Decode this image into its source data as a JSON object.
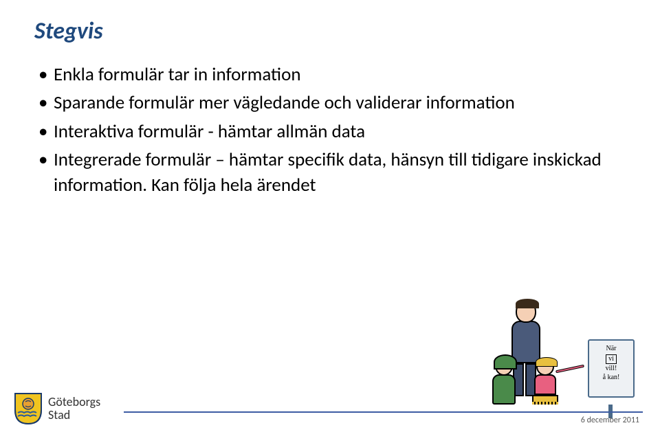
{
  "title": "Stegvis",
  "bullets": [
    "Enkla formulär tar in information",
    "Sparande formulär mer vägledande och validerar information",
    "Interaktiva formulär - hämtar allmän data",
    "Integrerade formulär – hämtar specifik data, hänsyn till tidigare inskickad information. Kan följa hela ärendet"
  ],
  "logo": {
    "line1": "Göteborgs",
    "line2": "Stad"
  },
  "sign": {
    "line1": "När",
    "line2": "vi",
    "line3": "vill!",
    "line4": "å kan!"
  },
  "footer_date": "6 december 2011"
}
